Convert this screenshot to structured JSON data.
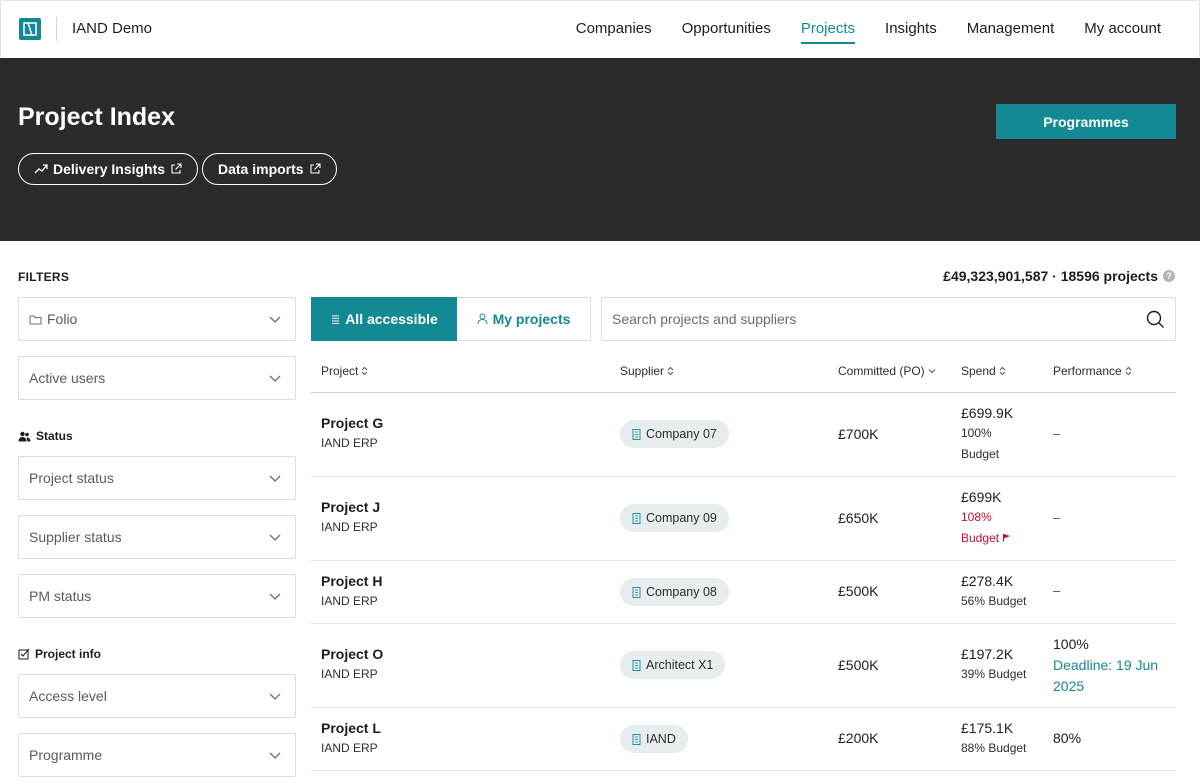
{
  "nav": {
    "brand": "IAND Demo",
    "links": [
      {
        "label": "Companies",
        "active": false
      },
      {
        "label": "Opportunities",
        "active": false
      },
      {
        "label": "Projects",
        "active": true
      },
      {
        "label": "Insights",
        "active": false
      },
      {
        "label": "Management",
        "active": false
      },
      {
        "label": "My account",
        "active": false
      }
    ]
  },
  "hero": {
    "title": "Project Index",
    "delivery_insights": "Delivery Insights",
    "data_imports": "Data imports",
    "programmes": "Programmes"
  },
  "filters": {
    "title": "FILTERS",
    "folio": "Folio",
    "active_users": "Active users",
    "status_title": "Status",
    "project_status": "Project status",
    "supplier_status": "Supplier status",
    "pm_status": "PM status",
    "project_info_title": "Project info",
    "access_level": "Access level",
    "programme": "Programme"
  },
  "summary": {
    "total": "£49,323,901,587 · 18596 projects"
  },
  "segments": {
    "all": "All accessible",
    "mine": "My projects"
  },
  "search": {
    "placeholder": "Search projects and suppliers"
  },
  "table": {
    "headers": {
      "project": "Project",
      "supplier": "Supplier",
      "committed": "Committed (PO)",
      "spend": "Spend",
      "performance": "Performance"
    },
    "rows": [
      {
        "name": "Project G",
        "source": "IAND ERP",
        "supplier": "Company 07",
        "committed": "£700K",
        "spend": "£699.9K",
        "spend_pct": "100%",
        "spend_label": "Budget",
        "over": false,
        "performance": "–"
      },
      {
        "name": "Project J",
        "source": "IAND ERP",
        "supplier": "Company 09",
        "committed": "£650K",
        "spend": "£699K",
        "spend_pct": "108%",
        "spend_label": "Budget",
        "over": true,
        "performance": "–"
      },
      {
        "name": "Project H",
        "source": "IAND ERP",
        "supplier": "Company 08",
        "committed": "£500K",
        "spend": "£278.4K",
        "spend_line": "56% Budget",
        "performance": "–"
      },
      {
        "name": "Project O",
        "source": "IAND ERP",
        "supplier": "Architect X1",
        "committed": "£500K",
        "spend": "£197.2K",
        "spend_line": "39% Budget",
        "performance": "100%",
        "deadline_1": "Deadline: 19 Jun",
        "deadline_2": "2025"
      },
      {
        "name": "Project L",
        "source": "IAND ERP",
        "supplier": "IAND",
        "committed": "£200K",
        "spend": "£175.1K",
        "spend_line": "88% Budget",
        "performance": "80%"
      }
    ]
  },
  "colors": {
    "accent": "#138a93",
    "hero_bg": "#2b2b2b",
    "over_budget": "#c8102e"
  }
}
